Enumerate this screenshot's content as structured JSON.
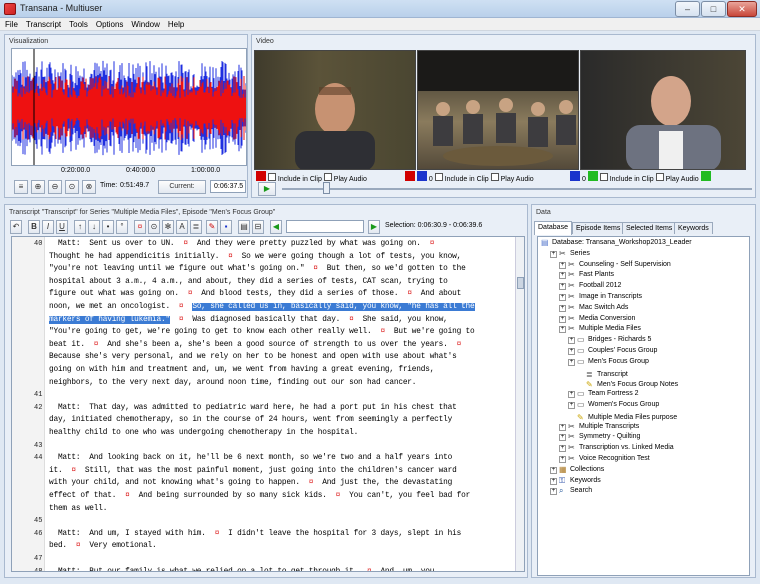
{
  "window": {
    "title": "Transana - Multiuser"
  },
  "menu": [
    "File",
    "Transcript",
    "Tools",
    "Options",
    "Window",
    "Help"
  ],
  "visualization": {
    "title": "Visualization",
    "ticks": [
      "0:20:00.0",
      "0:40:00.0",
      "1:00:00.0"
    ],
    "time_label": "Time:",
    "time_value": "0:51:49.7",
    "current_label": "Current:",
    "current_value": "0:06:37.5"
  },
  "video": {
    "title": "Video",
    "clips": [
      {
        "include": "Include in Clip",
        "play": "Play Audio",
        "ch1": "0"
      },
      {
        "include": "Include in Clip",
        "play": "Play Audio",
        "ch1": "0"
      },
      {
        "include": "Include in Clip",
        "play": "Play Audio",
        "ch1": "0"
      }
    ]
  },
  "transcript": {
    "title": "Transcript \"Transcript\" for Series \"Multiple Media Files\", Episode \"Men's Focus Group\"",
    "selection": "Selection: 0:06:30.9 - 0:06:39.6",
    "lines": [
      {
        "n": "40",
        "t": "  Matt:  Sent us over to UN.  ¤  And they were pretty puzzled by what was going on.  ¤"
      },
      {
        "n": "",
        "t": "Thought he had appendicitis initially.  ¤  So we were going though a lot of tests, you know,"
      },
      {
        "n": "",
        "t": "\"you're not leaving until we figure out what's going on.\"  ¤  But then, so we'd gotten to the"
      },
      {
        "n": "",
        "t": "hospital about 3 a.m., 4 a.m., and about, they did a series of tests, CAT scan, trying to"
      },
      {
        "n": "",
        "t": "figure out what was going on.  ¤  And blood tests, they did a series of those.  ¤  And about"
      },
      {
        "n": "",
        "t": "noon, we met an oncologist.  ¤  ",
        "h": "So, she called us in, basically said, you know, \"he has all the"
      },
      {
        "n": "",
        "t": "",
        "h": "markers of having lukemia.\"",
        "a": "  ¤  Was diagnosed basically that day.  ¤  She said, you know,"
      },
      {
        "n": "",
        "t": "\"You're going to get, we're going to get to know each other really well.  ¤  But we're going to"
      },
      {
        "n": "",
        "t": "beat it.  ¤  And she's been a, she's been a good source of strength to us over the years.  ¤"
      },
      {
        "n": "",
        "t": "Because she's very personal, and we rely on her to be honest and open with use about what's"
      },
      {
        "n": "",
        "t": "going on with him and treatment and, um, we went from having a great evening, friends,"
      },
      {
        "n": "",
        "t": "neighbors, to the very next day, around noon time, finding out our son had cancer."
      },
      {
        "n": "41",
        "t": ""
      },
      {
        "n": "42",
        "t": "  Matt:  That day, was admitted to pediatric ward here, he had a port put in his chest that"
      },
      {
        "n": "",
        "t": "day, initiated chemotherapy, so in the course of 24 hours, went from seemingly a perfectly"
      },
      {
        "n": "",
        "t": "healthy child to one who was undergoing chemotherapy in the hospital."
      },
      {
        "n": "43",
        "t": ""
      },
      {
        "n": "44",
        "t": "  Matt:  And looking back on it, he'll be 6 next month, so we're two and a half years into"
      },
      {
        "n": "",
        "t": "it.  ¤  Still, that was the most painful moment, just going into the children's cancer ward"
      },
      {
        "n": "",
        "t": "with your child, and not knowing what's going to happen.  ¤  And just the, the devastating"
      },
      {
        "n": "",
        "t": "effect of that.  ¤  And being surrounded by so many sick kids.  ¤  You can't, you feel bad for"
      },
      {
        "n": "",
        "t": "them as well."
      },
      {
        "n": "45",
        "t": ""
      },
      {
        "n": "46",
        "t": "  Matt:  And um, I stayed with him.  ¤  I didn't leave the hospital for 3 days, slept in his"
      },
      {
        "n": "",
        "t": "bed.  ¤  Very emotional."
      },
      {
        "n": "47",
        "t": ""
      },
      {
        "n": "48",
        "t": "  Matt:  But our family is what we relied on a lot to get through it.  ¤  And, um, you"
      },
      {
        "n": "",
        "t": "gradually, you deal with it, you get used to the fact, the fact of medications and him getting"
      },
      {
        "n": "",
        "t": "used to it.  ¤  And he hated ground up pills, and having to take those daily medications, and"
      }
    ]
  },
  "data": {
    "title": "Data",
    "tabs": [
      "Database",
      "Episode Items",
      "Selected Items",
      "Keywords"
    ],
    "tree": [
      {
        "d": 0,
        "i": "db",
        "t": "Database: Transana_Workshop2013_Leader"
      },
      {
        "d": 1,
        "i": "series",
        "t": "Series"
      },
      {
        "d": 2,
        "i": "series",
        "t": "Counseling - Self Supervision"
      },
      {
        "d": 2,
        "i": "series",
        "t": "Fast Plants"
      },
      {
        "d": 2,
        "i": "series",
        "t": "Football 2012"
      },
      {
        "d": 2,
        "i": "series",
        "t": "Image in Transcripts"
      },
      {
        "d": 2,
        "i": "series",
        "t": "Mac Switch Ads"
      },
      {
        "d": 2,
        "i": "series",
        "t": "Media Conversion"
      },
      {
        "d": 2,
        "i": "series",
        "t": "Multiple Media Files"
      },
      {
        "d": 3,
        "i": "ep",
        "t": "Bridges - Richards 5"
      },
      {
        "d": 3,
        "i": "ep",
        "t": "Couples' Focus Group"
      },
      {
        "d": 3,
        "i": "ep",
        "t": "Men's Focus Group"
      },
      {
        "d": 4,
        "i": "tr",
        "t": "Transcript"
      },
      {
        "d": 4,
        "i": "note",
        "t": "Men's Focus Group Notes"
      },
      {
        "d": 3,
        "i": "ep",
        "t": "Team Fortress 2"
      },
      {
        "d": 3,
        "i": "ep",
        "t": "Women's Focus Group"
      },
      {
        "d": 3,
        "i": "note",
        "t": "Multiple Media Files purpose"
      },
      {
        "d": 2,
        "i": "series",
        "t": "Multiple Transcripts"
      },
      {
        "d": 2,
        "i": "series",
        "t": "Symmetry - Quilting"
      },
      {
        "d": 2,
        "i": "series",
        "t": "Transcription vs. Linked Media"
      },
      {
        "d": 2,
        "i": "series",
        "t": "Voice Recognition Test"
      },
      {
        "d": 1,
        "i": "coll",
        "t": "Collections"
      },
      {
        "d": 1,
        "i": "kw",
        "t": "Keywords"
      },
      {
        "d": 1,
        "i": "search",
        "t": "Search"
      }
    ]
  }
}
